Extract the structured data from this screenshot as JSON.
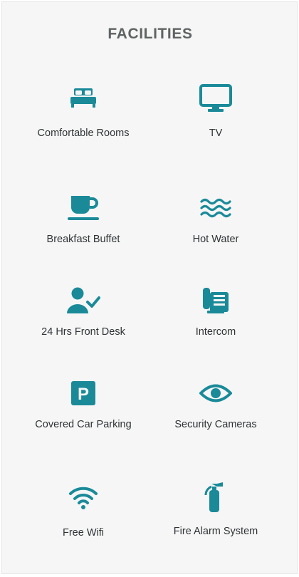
{
  "page": {
    "title": "FACILITIES"
  },
  "colors": {
    "accent": "#1a8a99",
    "text": "#2f3335",
    "title": "#5f6364",
    "background": "#f6f6f6"
  },
  "facilities": [
    {
      "label": "Comfortable Rooms",
      "icon": "bed-icon"
    },
    {
      "label": "TV",
      "icon": "tv-icon"
    },
    {
      "label": "Breakfast Buffet",
      "icon": "coffee-cup-icon"
    },
    {
      "label": "Hot Water",
      "icon": "water-waves-icon"
    },
    {
      "label": "24 Hrs Front Desk",
      "icon": "user-check-icon"
    },
    {
      "label": "Intercom",
      "icon": "intercom-phone-icon"
    },
    {
      "label": "Covered Car Parking",
      "icon": "parking-icon"
    },
    {
      "label": "Security Cameras",
      "icon": "eye-icon"
    },
    {
      "label": "Free Wifi",
      "icon": "wifi-icon"
    },
    {
      "label": "Fire Alarm System",
      "icon": "fire-extinguisher-icon"
    }
  ]
}
